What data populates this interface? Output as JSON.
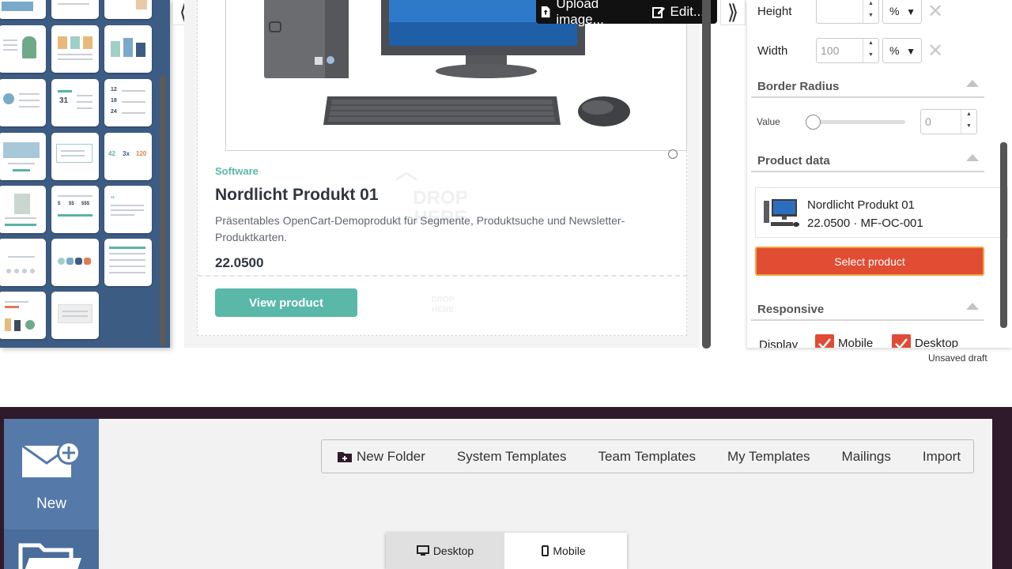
{
  "editor": {
    "image_toolbar": {
      "upload_label": "Upload image...",
      "edit_label": "Edit..."
    },
    "product_block": {
      "category": "Software",
      "title": "Nordlicht Produkt 01",
      "description": "Präsentables OpenCart-Demoprodukt für Segmente, Produktsuche und Newsletter-Produktkarten.",
      "price": "22.0500",
      "button_label": "View product"
    },
    "drop_placeholder": "DROP HERE",
    "collapse_left_icon": "double-chevron-left-icon",
    "collapse_right_icon": "double-chevron-right-icon"
  },
  "properties": {
    "height": {
      "label": "Height",
      "value": "",
      "unit": "%"
    },
    "width": {
      "label": "Width",
      "value": "100",
      "unit": "%"
    },
    "border_radius": {
      "section_title": "Border Radius",
      "value_label": "Value",
      "value": "0",
      "slider_fraction": 0.0
    },
    "product_data": {
      "section_title": "Product data",
      "product_name": "Nordlicht Produkt 01",
      "product_meta": "22.0500 · MF-OC-001",
      "select_button": "Select product"
    },
    "responsive": {
      "section_title": "Responsive",
      "display_label": "Display",
      "mobile_label": "Mobile",
      "desktop_label": "Desktop",
      "mobile_checked": true,
      "desktop_checked": true
    },
    "status": "Unsaved draft"
  },
  "app": {
    "sidebar": {
      "new_label": "New"
    },
    "nav": {
      "new_folder": "New Folder",
      "system_templates": "System Templates",
      "team_templates": "Team Templates",
      "my_templates": "My Templates",
      "mailings": "Mailings",
      "import": "Import"
    },
    "view_toggle": {
      "desktop": "Desktop",
      "mobile": "Mobile",
      "selected": "Desktop"
    }
  },
  "colors": {
    "accent_teal": "#5ab8a9",
    "sidebar_blue": "#4f72a1",
    "select_button": "#e04d33",
    "check_red": "#df4b36"
  }
}
